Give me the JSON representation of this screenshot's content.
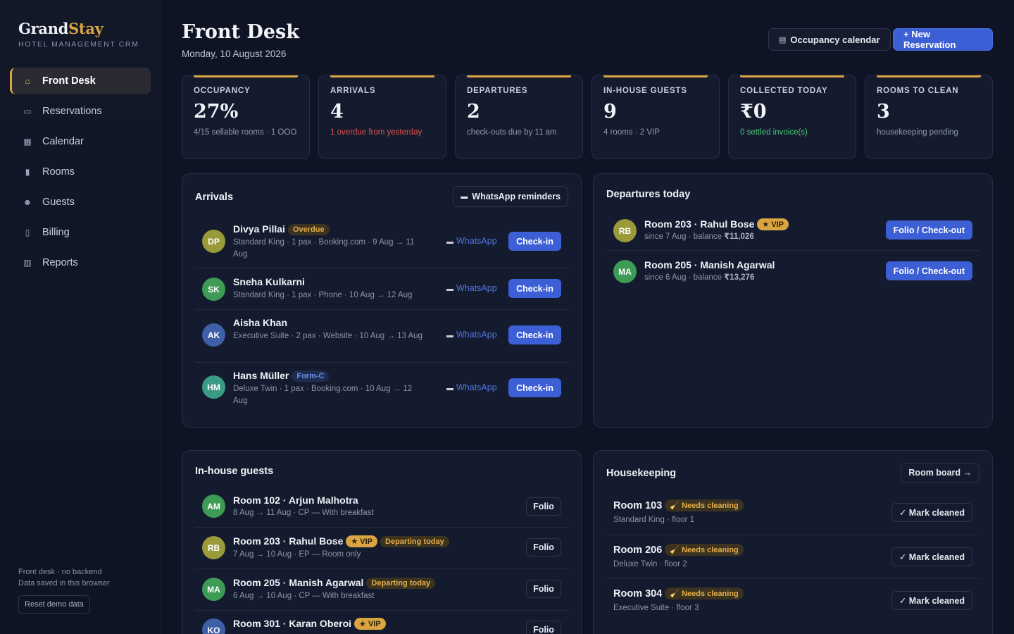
{
  "brand": {
    "name_part1": "Grand",
    "name_part2": "Stay",
    "subtitle": "HOTEL MANAGEMENT CRM"
  },
  "nav": [
    {
      "label": "Front Desk",
      "icon": "home-icon",
      "glyph": "⌂",
      "active": true
    },
    {
      "label": "Reservations",
      "icon": "book-icon",
      "glyph": "▭"
    },
    {
      "label": "Calendar",
      "icon": "calendar-icon",
      "glyph": "▦"
    },
    {
      "label": "Rooms",
      "icon": "door-icon",
      "glyph": "▮"
    },
    {
      "label": "Guests",
      "icon": "people-icon",
      "glyph": "☻"
    },
    {
      "label": "Billing",
      "icon": "receipt-icon",
      "glyph": "▯"
    },
    {
      "label": "Reports",
      "icon": "bar-chart-icon",
      "glyph": "▥"
    }
  ],
  "sidebar_footer": {
    "line1": "Front desk · no backend",
    "line2": "Data saved in this browser",
    "reset_label": "Reset demo data"
  },
  "header": {
    "title": "Front Desk",
    "date": "Monday, 10 August 2026",
    "occupancy_btn": "Occupancy calendar",
    "occupancy_glyph": "▤",
    "new_btn": "+ New Reservation"
  },
  "kpis": [
    {
      "label": "OCCUPANCY",
      "value": "27%",
      "sub": "4/15 sellable rooms · 1 OOO",
      "tone": "muted"
    },
    {
      "label": "ARRIVALS",
      "value": "4",
      "sub": "1 overdue from yesterday",
      "tone": "red"
    },
    {
      "label": "DEPARTURES",
      "value": "2",
      "sub": "check-outs due by 11 am",
      "tone": "muted"
    },
    {
      "label": "IN-HOUSE GUESTS",
      "value": "9",
      "sub": "4 rooms · 2 VIP",
      "tone": "muted"
    },
    {
      "label": "COLLECTED TODAY",
      "value": "₹0",
      "sub": "0 settled invoice(s)",
      "tone": "green"
    },
    {
      "label": "ROOMS TO CLEAN",
      "value": "3",
      "sub": "housekeeping pending",
      "tone": "muted"
    }
  ],
  "arrivals": {
    "title": "Arrivals",
    "reminders_btn": "WhatsApp reminders",
    "whatsapp_label": "WhatsApp",
    "checkin_label": "Check-in",
    "items": [
      {
        "initials": "DP",
        "name": "Divya Pillai",
        "badge": "Overdue",
        "meta": "Standard King · 1 pax · Booking.com · 9 Aug → 11 Aug"
      },
      {
        "initials": "SK",
        "name": "Sneha Kulkarni",
        "badge": "",
        "meta": "Standard King · 1 pax · Phone · 10 Aug → 12 Aug"
      },
      {
        "initials": "AK",
        "name": "Aisha Khan",
        "badge": "",
        "meta": "Executive Suite · 2 pax · Website · 10 Aug → 13 Aug"
      },
      {
        "initials": "HM",
        "name": "Hans Müller",
        "badge": "Form-C",
        "meta": "Deluxe Twin · 1 pax · Booking.com · 10 Aug → 12 Aug"
      }
    ]
  },
  "departures": {
    "title": "Departures today",
    "btn_label": "Folio / Check-out",
    "items": [
      {
        "initials": "RB",
        "name": "Room 203 · Rahul Bose",
        "badge": "★ VIP",
        "meta_prefix": "since 7 Aug · balance ",
        "balance": "₹11,026"
      },
      {
        "initials": "MA",
        "name": "Room 205 · Manish Agarwal",
        "badge": "",
        "meta_prefix": "since 6 Aug · balance ",
        "balance": "₹13,276"
      }
    ]
  },
  "inhouse": {
    "title": "In-house guests",
    "folio_label": "Folio",
    "items": [
      {
        "initials": "AM",
        "name": "Room 102 · Arjun Malhotra",
        "badges": [],
        "meta": "8 Aug → 11 Aug · CP — With breakfast"
      },
      {
        "initials": "RB",
        "name": "Room 203 · Rahul Bose",
        "badges": [
          "★ VIP",
          "Departing today"
        ],
        "meta": "7 Aug → 10 Aug · EP — Room only"
      },
      {
        "initials": "MA",
        "name": "Room 205 · Manish Agarwal",
        "badges": [
          "Departing today"
        ],
        "meta": "6 Aug → 10 Aug · CP — With breakfast"
      },
      {
        "initials": "KO",
        "name": "Room 301 · Karan Oberoi",
        "badges": [
          "★ VIP"
        ],
        "meta": ""
      }
    ]
  },
  "housekeeping": {
    "title": "Housekeeping",
    "room_board_btn": "Room board →",
    "mark_label": "✓ Mark cleaned",
    "items": [
      {
        "room": "Room 103",
        "status": "🧹 Needs cleaning",
        "meta": "Standard King · floor 1"
      },
      {
        "room": "Room 206",
        "status": "🧹 Needs cleaning",
        "meta": "Deluxe Twin · floor 2"
      },
      {
        "room": "Room 304",
        "status": "🧹 Needs cleaning",
        "meta": "Executive Suite · floor 3"
      }
    ]
  },
  "colors": {
    "accent_gold": "#d9a441",
    "primary_blue": "#3d5fd6",
    "background": "#0f1424",
    "card": "#151b2e",
    "danger": "#e0504d",
    "success": "#4cc47a"
  }
}
